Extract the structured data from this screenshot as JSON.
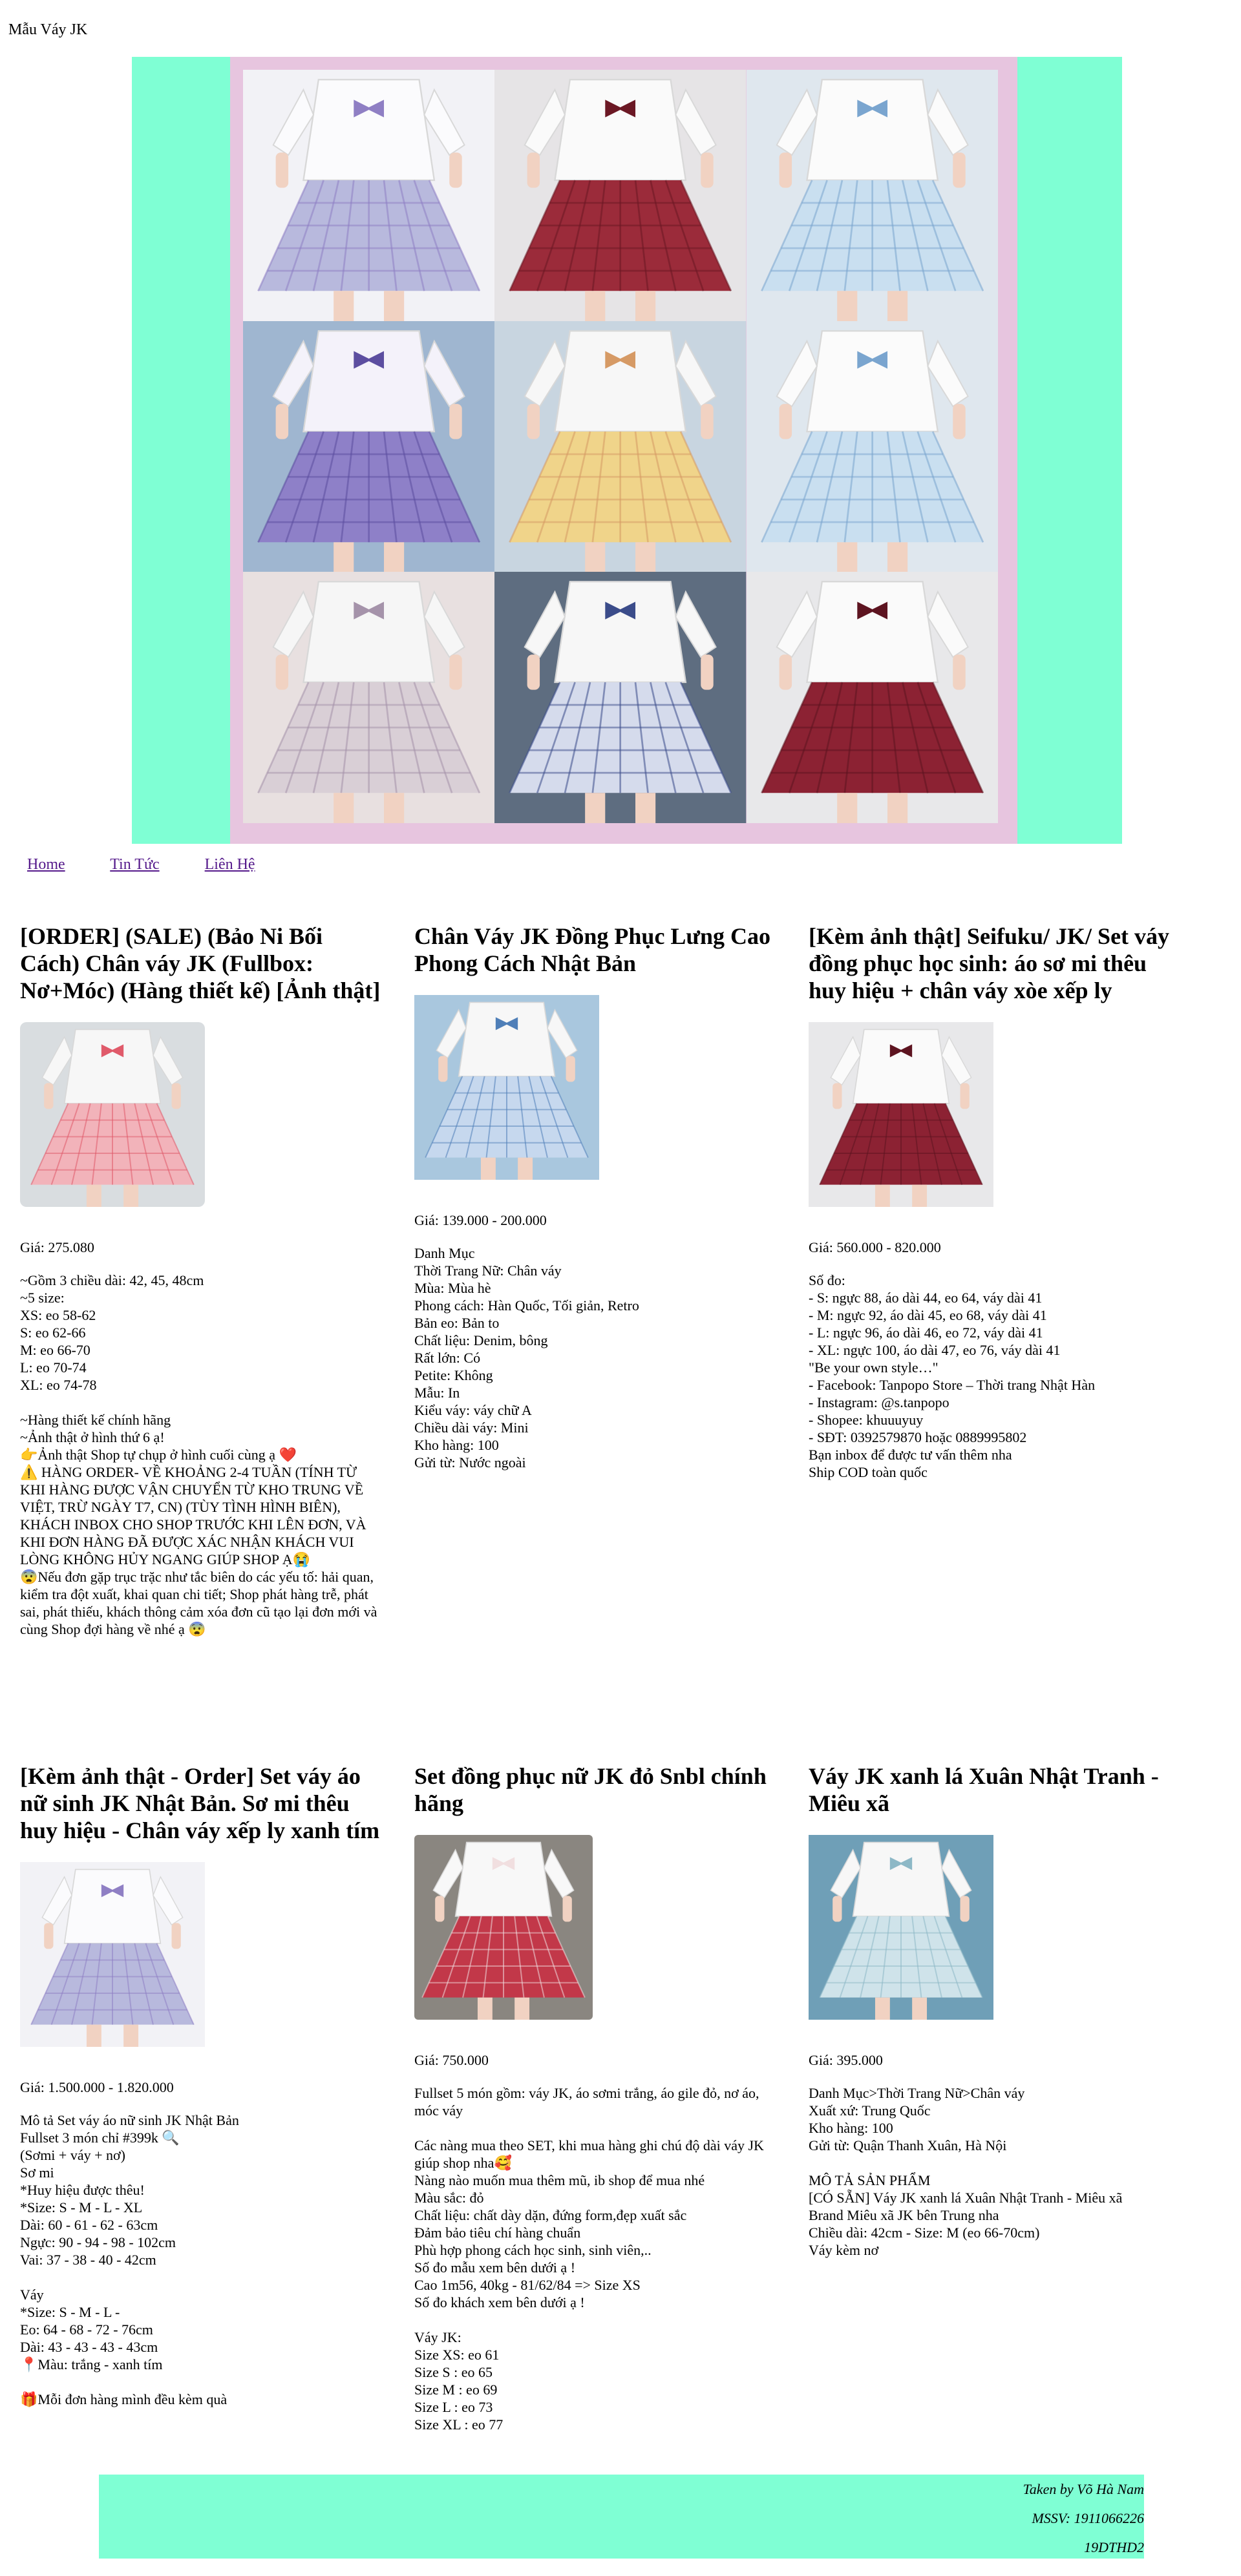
{
  "site": {
    "title": "Mẫu Váy JK"
  },
  "nav": {
    "items": [
      "Home",
      "Tin Tức",
      "Liên Hệ"
    ]
  },
  "colors": {
    "banner_bg": "#7fffd4",
    "banner_frame": "#e7c5df",
    "footer_bg": "#7fffd4",
    "link": "#551a8b"
  },
  "products": [
    {
      "title": "[ORDER] (SALE) (Bảo Ni Bối Cách) Chân váy JK (Fullbox: Nơ+Móc) (Hàng thiết kế) [Ảnh thật]",
      "price": "Giá: 275.080",
      "desc": [
        "~Gồm 3 chiều dài: 42, 45, 48cm",
        "~5 size:",
        "XS: eo 58-62",
        "S: eo 62-66",
        "M: eo 66-70",
        "L: eo 70-74",
        "XL: eo 74-78",
        "",
        "~Hàng thiết kế chính hãng",
        "~Ảnh thật ở hình thứ 6 ạ!",
        "👉Ảnh thật Shop tự chụp ở hình cuối cùng ạ ❤️",
        "⚠️ HÀNG ORDER- VỀ KHOẢNG 2-4 TUẦN (TÍNH TỪ KHI HÀNG ĐƯỢC VẬN CHUYỂN TỪ KHO TRUNG VỀ VIỆT, TRỪ NGÀY T7, CN) (TÙY TÌNH HÌNH BIÊN), KHÁCH INBOX CHO SHOP TRƯỚC KHI LÊN ĐƠN, VÀ KHI ĐƠN HÀNG ĐÃ ĐƯỢC XÁC NHẬN KHÁCH VUI LÒNG KHÔNG HỦY NGANG GIÚP SHOP Ạ😭",
        "😨Nếu đơn gặp trục trặc như tắc biên do các yếu tố: hải quan, kiểm tra đột xuất, khai quan chi tiết; Shop phát hàng trễ, phát sai, phát thiếu, khách thông cảm xóa đơn cũ tạo lại đơn mới và cùng Shop đợi hàng về nhé ạ 😨"
      ]
    },
    {
      "title": "Chân Váy JK Đồng Phục Lưng Cao Phong Cách Nhật Bản",
      "price": "Giá: 139.000 - 200.000",
      "desc": [
        "Danh Mục",
        "Thời Trang Nữ: Chân váy",
        "Mùa: Mùa hè",
        "Phong cách: Hàn Quốc, Tối giản, Retro",
        "Bản eo: Bản to",
        "Chất liệu: Denim, bông",
        "Rất lớn: Có",
        "Petite: Không",
        "Mẫu: In",
        "Kiểu váy: váy chữ A",
        "Chiều dài váy: Mini",
        "Kho hàng: 100",
        "Gửi từ: Nước ngoài"
      ]
    },
    {
      "title": "[Kèm ảnh thật] Seifuku/ JK/ Set váy đồng phục học sinh: áo sơ mi thêu huy hiệu + chân váy xòe xếp ly",
      "price": "Giá: 560.000 - 820.000",
      "desc": [
        "Số đo:",
        "- S: ngực 88, áo dài 44, eo 64, váy dài 41",
        "- M: ngực 92, áo dài 45, eo 68, váy dài 41",
        "- L: ngực 96, áo dài 46, eo 72, váy dài 41",
        "- XL: ngực 100, áo dài 47, eo 76, váy dài 41",
        "\"Be your own style…\"",
        "- Facebook: Tanpopo Store – Thời trang Nhật Hàn",
        "- Instagram: @s.tanpopo",
        "- Shopee: khuuuyuy",
        "- SĐT: 0392579870 hoặc 0889995802",
        "Bạn inbox để được tư vấn thêm nha",
        "Ship COD toàn quốc"
      ]
    },
    {
      "title": "[Kèm ảnh thật - Order] Set váy áo nữ sinh JK Nhật Bản. Sơ mi thêu huy hiệu - Chân váy xếp ly xanh tím",
      "price": "Giá: 1.500.000 - 1.820.000",
      "desc": [
        "Mô tả Set váy áo nữ sinh JK Nhật Bản",
        "Fullset 3 món chỉ #399k 🔍",
        "(Sơmi + váy + nơ)",
        "Sơ mi",
        "*Huy hiệu được thêu!",
        "*Size: S - M - L - XL",
        "Dài: 60 - 61 - 62 - 63cm",
        "Ngực: 90 - 94 - 98 - 102cm",
        "Vai: 37 - 38 - 40 - 42cm",
        "",
        "Váy",
        "*Size: S - M - L -",
        "Eo: 64 - 68 - 72 - 76cm",
        "Dài: 43 - 43 - 43 - 43cm",
        "📍Màu: trắng - xanh tím",
        "",
        "🎁Mỗi đơn hàng mình đều kèm quà"
      ]
    },
    {
      "title": "Set đồng phục nữ JK đỏ Snbl chính hãng",
      "price": "Giá: 750.000",
      "desc": [
        "Fullset 5 món gồm: váy JK, áo sơmi trắng, áo gile đỏ, nơ áo, móc váy",
        "",
        "Các nàng mua theo SET, khi mua hàng ghi chú độ dài váy JK giúp shop nha🥰",
        "Nàng nào muốn mua thêm mũ, ib shop để mua nhé",
        "Màu sắc: đỏ",
        "Chất liệu: chất dày dặn, đứng form,đẹp xuất sắc",
        "Đảm bảo tiêu chí hàng chuẩn",
        "Phù hợp phong cách học sinh, sinh viên,..",
        "Số đo mẫu xem bên dưới ạ !",
        "Cao 1m56, 40kg - 81/62/84 => Size XS",
        "Số đo khách xem bên dưới ạ !",
        "",
        "Váy JK:",
        "Size XS: eo 61",
        "Size S : eo 65",
        "Size M : eo 69",
        "Size L : eo 73",
        "Size XL : eo 77"
      ]
    },
    {
      "title": "Váy JK xanh lá Xuân Nhật Tranh - Miêu xã",
      "price": "Giá: 395.000",
      "desc": [
        "Danh Mục>Thời Trang Nữ>Chân váy",
        "Xuất xứ: Trung Quốc",
        "Kho hàng: 100",
        "Gửi từ: Quận Thanh Xuân, Hà Nội",
        "",
        "MÔ TẢ SẢN PHẨM",
        "[CÓ SẴN] Váy JK xanh lá Xuân Nhật Tranh - Miêu xã",
        "Brand Miêu xã JK bên Trung nha",
        "Chiều dài: 42cm - Size: M (eo 66-70cm)",
        "Váy kèm nơ"
      ]
    }
  ],
  "footer": {
    "lines": [
      "Taken by Võ Hà Nam",
      "MSSV: 1911066226",
      "19DTHD2"
    ]
  }
}
